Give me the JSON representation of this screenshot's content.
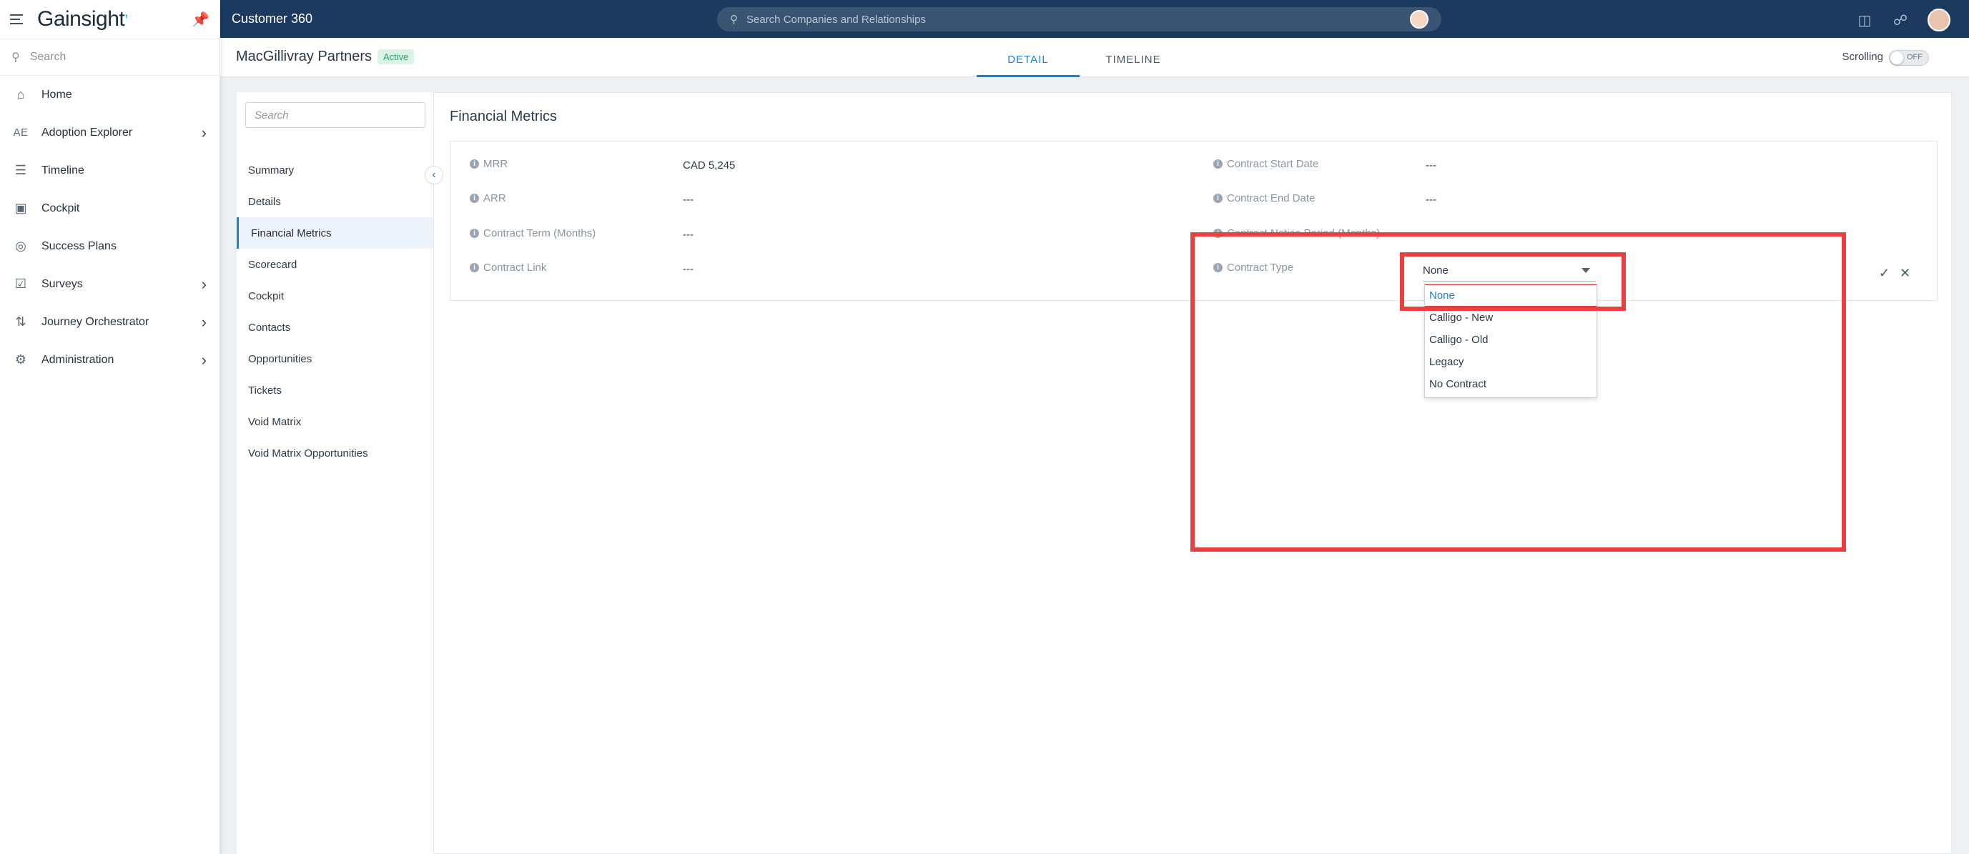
{
  "sidebar": {
    "logo": "Gainsight",
    "search_placeholder": "Search",
    "items": [
      {
        "label": "Home",
        "icon": "home-icon"
      },
      {
        "label": "Adoption Explorer",
        "icon": "AE",
        "has_children": true
      },
      {
        "label": "Timeline",
        "icon": "timeline-icon"
      },
      {
        "label": "Cockpit",
        "icon": "cockpit-icon"
      },
      {
        "label": "Success Plans",
        "icon": "target-icon"
      },
      {
        "label": "Surveys",
        "icon": "survey-icon",
        "has_children": true
      },
      {
        "label": "Journey Orchestrator",
        "icon": "journey-icon",
        "has_children": true
      },
      {
        "label": "Administration",
        "icon": "gear-icon",
        "has_children": true
      }
    ]
  },
  "topbar": {
    "title": "Customer 360",
    "search_placeholder": "Search Companies and Relationships"
  },
  "header": {
    "company_name": "MacGillivray Partners",
    "status": "Active",
    "tabs": [
      "DETAIL",
      "TIMELINE"
    ],
    "active_tab": "DETAIL",
    "scrolling_label": "Scrolling",
    "scrolling_state": "OFF"
  },
  "subnav": {
    "search_placeholder": "Search",
    "items": [
      "Summary",
      "Details",
      "Financial Metrics",
      "Scorecard",
      "Cockpit",
      "Contacts",
      "Opportunities",
      "Tickets",
      "Void Matrix",
      "Void Matrix Opportunities"
    ],
    "active": "Financial Metrics"
  },
  "section": {
    "title": "Financial Metrics",
    "fields_left": [
      {
        "label": "MRR",
        "value": "CAD 5,245"
      },
      {
        "label": "ARR",
        "value": "---"
      },
      {
        "label": "Contract Term (Months)",
        "value": "---"
      },
      {
        "label": "Contract Link",
        "value": "---"
      }
    ],
    "fields_right": [
      {
        "label": "Contract Start Date",
        "value": "---"
      },
      {
        "label": "Contract End Date",
        "value": "---"
      },
      {
        "label": "Contract Notice Period (Months)",
        "value": ""
      },
      {
        "label": "Contract Type",
        "value": "None"
      }
    ]
  },
  "dropdown": {
    "selected": "None",
    "options": [
      "None",
      "Calligo - New",
      "Calligo - Old",
      "Legacy",
      "No Contract"
    ]
  },
  "colors": {
    "topbar": "#1c3a5e",
    "accent": "#1e7fd6",
    "highlight": "#e8403f",
    "active_badge_bg": "#d9f3e6"
  }
}
